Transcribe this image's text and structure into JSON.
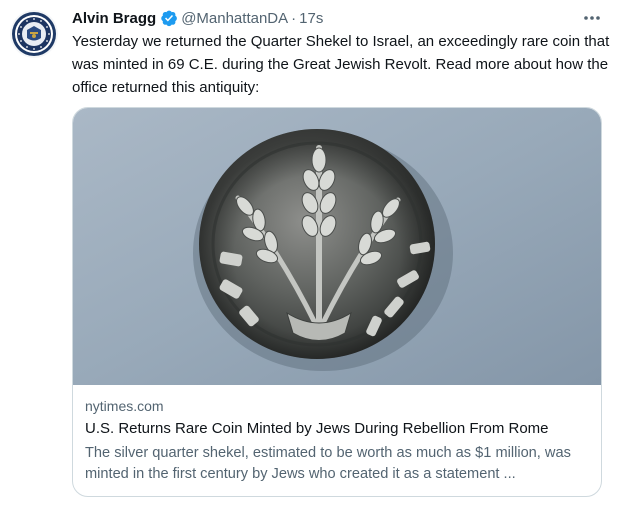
{
  "tweet": {
    "author_name": "Alvin Bragg",
    "handle": "@ManhattanDA",
    "separator": "·",
    "time": "17s",
    "more_glyph": "···",
    "text": "Yesterday we returned the Quarter Shekel to Israel, an exceedingly rare coin that was minted in 69 C.E. during the Great Jewish Revolt. Read more about how the office returned this antiquity:",
    "icons": {
      "verified": "verified-badge-icon",
      "more": "more-options-icon"
    },
    "colors": {
      "verified_badge": "#1d9bf0",
      "secondary_text": "#536471",
      "card_border": "#cfd9de"
    }
  },
  "card": {
    "image_alt": "Silver quarter shekel coin",
    "domain": "nytimes.com",
    "title": "U.S. Returns Rare Coin Minted by Jews During Rebellion From Rome",
    "description": "The silver quarter shekel, estimated to be worth as much as $1 million, was minted in the first century by Jews who created it as a statement ..."
  }
}
